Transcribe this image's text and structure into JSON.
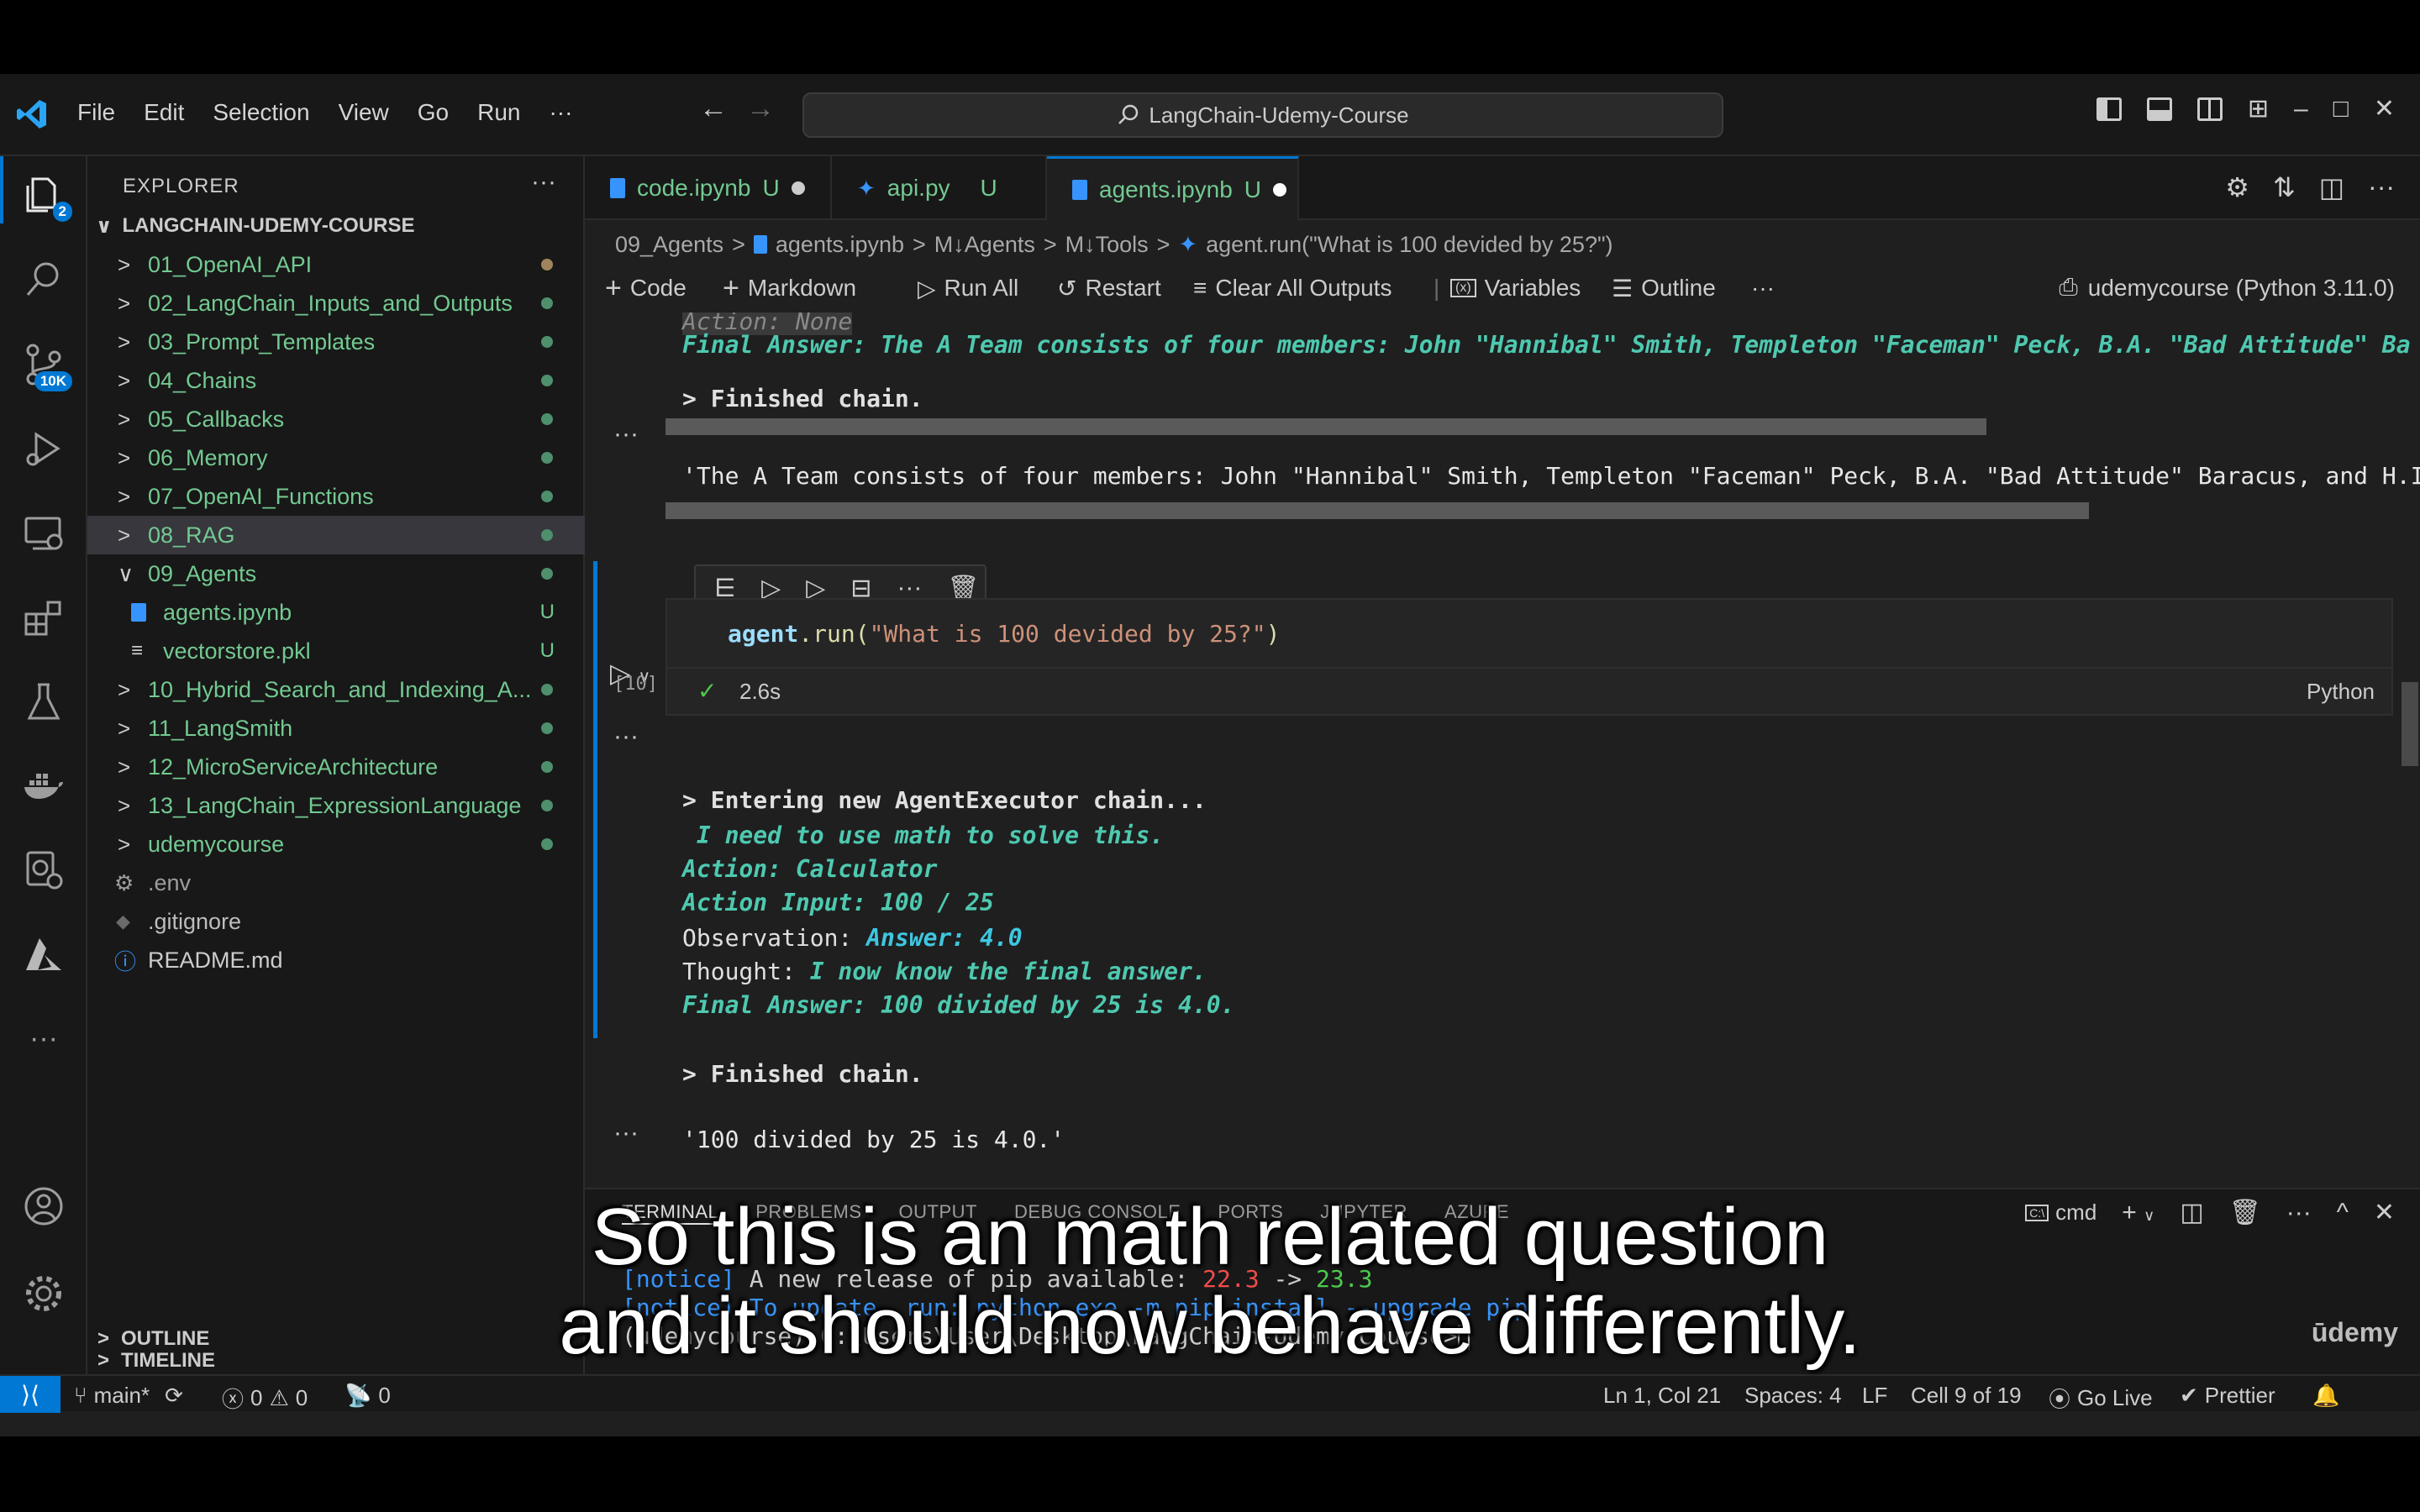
{
  "app": {
    "menu": [
      "File",
      "Edit",
      "Selection",
      "View",
      "Go",
      "Run",
      "···"
    ],
    "search": "LangChain-Udemy-Course"
  },
  "activity": {
    "explorer_badge": "2",
    "scm_badge": "10K"
  },
  "sidebar": {
    "title": "EXPLORER",
    "more": "···",
    "root": "LANGCHAIN-UDEMY-COURSE",
    "items": [
      {
        "label": "01_OpenAI_API",
        "chev": ">"
      },
      {
        "label": "02_LangChain_Inputs_and_Outputs",
        "chev": ">"
      },
      {
        "label": "03_Prompt_Templates",
        "chev": ">"
      },
      {
        "label": "04_Chains",
        "chev": ">"
      },
      {
        "label": "05_Callbacks",
        "chev": ">"
      },
      {
        "label": "06_Memory",
        "chev": ">"
      },
      {
        "label": "07_OpenAI_Functions",
        "chev": ">"
      },
      {
        "label": "08_RAG",
        "chev": ">"
      },
      {
        "label": "09_Agents",
        "chev": "∨"
      },
      {
        "label": "agents.ipynb",
        "decoration": "U"
      },
      {
        "label": "vectorstore.pkl",
        "decoration": "U"
      },
      {
        "label": "10_Hybrid_Search_and_Indexing_A...",
        "chev": ">"
      },
      {
        "label": "11_LangSmith",
        "chev": ">"
      },
      {
        "label": "12_MicroServiceArchitecture",
        "chev": ">"
      },
      {
        "label": "13_LangChain_ExpressionLanguage",
        "chev": ">"
      },
      {
        "label": "udemycourse",
        "chev": ">"
      },
      {
        "label": ".env"
      },
      {
        "label": ".gitignore"
      },
      {
        "label": "README.md"
      }
    ],
    "outline": "OUTLINE",
    "timeline": "TIMELINE"
  },
  "tabs": [
    {
      "label": "code.ipynb",
      "status": "U"
    },
    {
      "label": "api.py",
      "status": "U"
    },
    {
      "label": "agents.ipynb",
      "status": "U"
    }
  ],
  "breadcrumb": [
    "09_Agents",
    "agents.ipynb",
    "M↓Agents",
    "M↓Tools",
    "agent.run(\"What is 100 devided by 25?\")"
  ],
  "toolbar": {
    "code": "Code",
    "markdown": "Markdown",
    "run_all": "Run All",
    "restart": "Restart",
    "clear": "Clear All Outputs",
    "variables": "Variables",
    "outline": "Outline",
    "more": "···",
    "kernel": "udemycourse (Python 3.11.0)"
  },
  "notebook": {
    "prev_action": "Action: None",
    "prev_final": "Final Answer: The A Team consists of four members: John \"Hannibal\" Smith, Templeton \"Faceman\" Peck, B.A. \"Bad Attitude\" Ba",
    "prev_finished": "> Finished chain.",
    "prev_result": "'The A Team consists of four members: John \"Hannibal\" Smith, Templeton \"Faceman\" Peck, B.A. \"Bad Attitude\" Baracus, and H.I",
    "cell_code_obj": "agent",
    "cell_code_fn": ".run(",
    "cell_code_str": "\"What is 100 devided by 25?\"",
    "cell_code_end": ")",
    "exec_count": "[10]",
    "duration": "2.6s",
    "language": "Python",
    "out_entering": "> Entering new AgentExecutor chain...",
    "out_thought1": " I need to use math to solve this.",
    "out_action": "Action: Calculator",
    "out_action_input": "Action Input: 100 / 25",
    "out_obs_label": "Observation: ",
    "out_obs_value": "Answer: 4.0",
    "out_thought_label": "Thought: ",
    "out_thought_value": "I now know the final answer.",
    "out_final": "Final Answer: 100 divided by 25 is 4.0.",
    "out_finished": "> Finished chain.",
    "out_result": "'100 divided by 25 is 4.0.'",
    "ellipsis": "···"
  },
  "panel": {
    "tabs": [
      "TERMINAL",
      "PROBLEMS",
      "OUTPUT",
      "DEBUG CONSOLE",
      "PORTS",
      "JUPYTER",
      "AZURE"
    ],
    "shell": "cmd",
    "line1_notice": "[notice]",
    "line1_text": " A new release of pip available: ",
    "line1_old": "22.3",
    "line1_arrow": " -> ",
    "line1_new": "23.3",
    "line2": "[notice] To update, run: python.exe -m pip install --upgrade pip",
    "line3": "(udemycourse) C:\\Users\\User\\Desktop\\LangChain-Udemy-Course>"
  },
  "statusbar": {
    "branch": "main*",
    "errors": "0",
    "warnings": "0",
    "ports": "0",
    "position": "Ln 1, Col 21",
    "spaces": "Spaces: 4",
    "eol": "LF",
    "cell": "Cell 9 of 19",
    "golive": "Go Live",
    "prettier": "Prettier"
  },
  "subtitles": {
    "line1": "So this is an math related question",
    "line2": "and it should now behave differently."
  },
  "watermark": "ūdemy",
  "colors": {
    "accent": "#0078d4",
    "git_added": "#73c991",
    "output_italic": "#4ec9b0",
    "string": "#ce9178",
    "notice": "#3794ff",
    "old_version": "#f14c4c",
    "new_version": "#4ec94e"
  }
}
